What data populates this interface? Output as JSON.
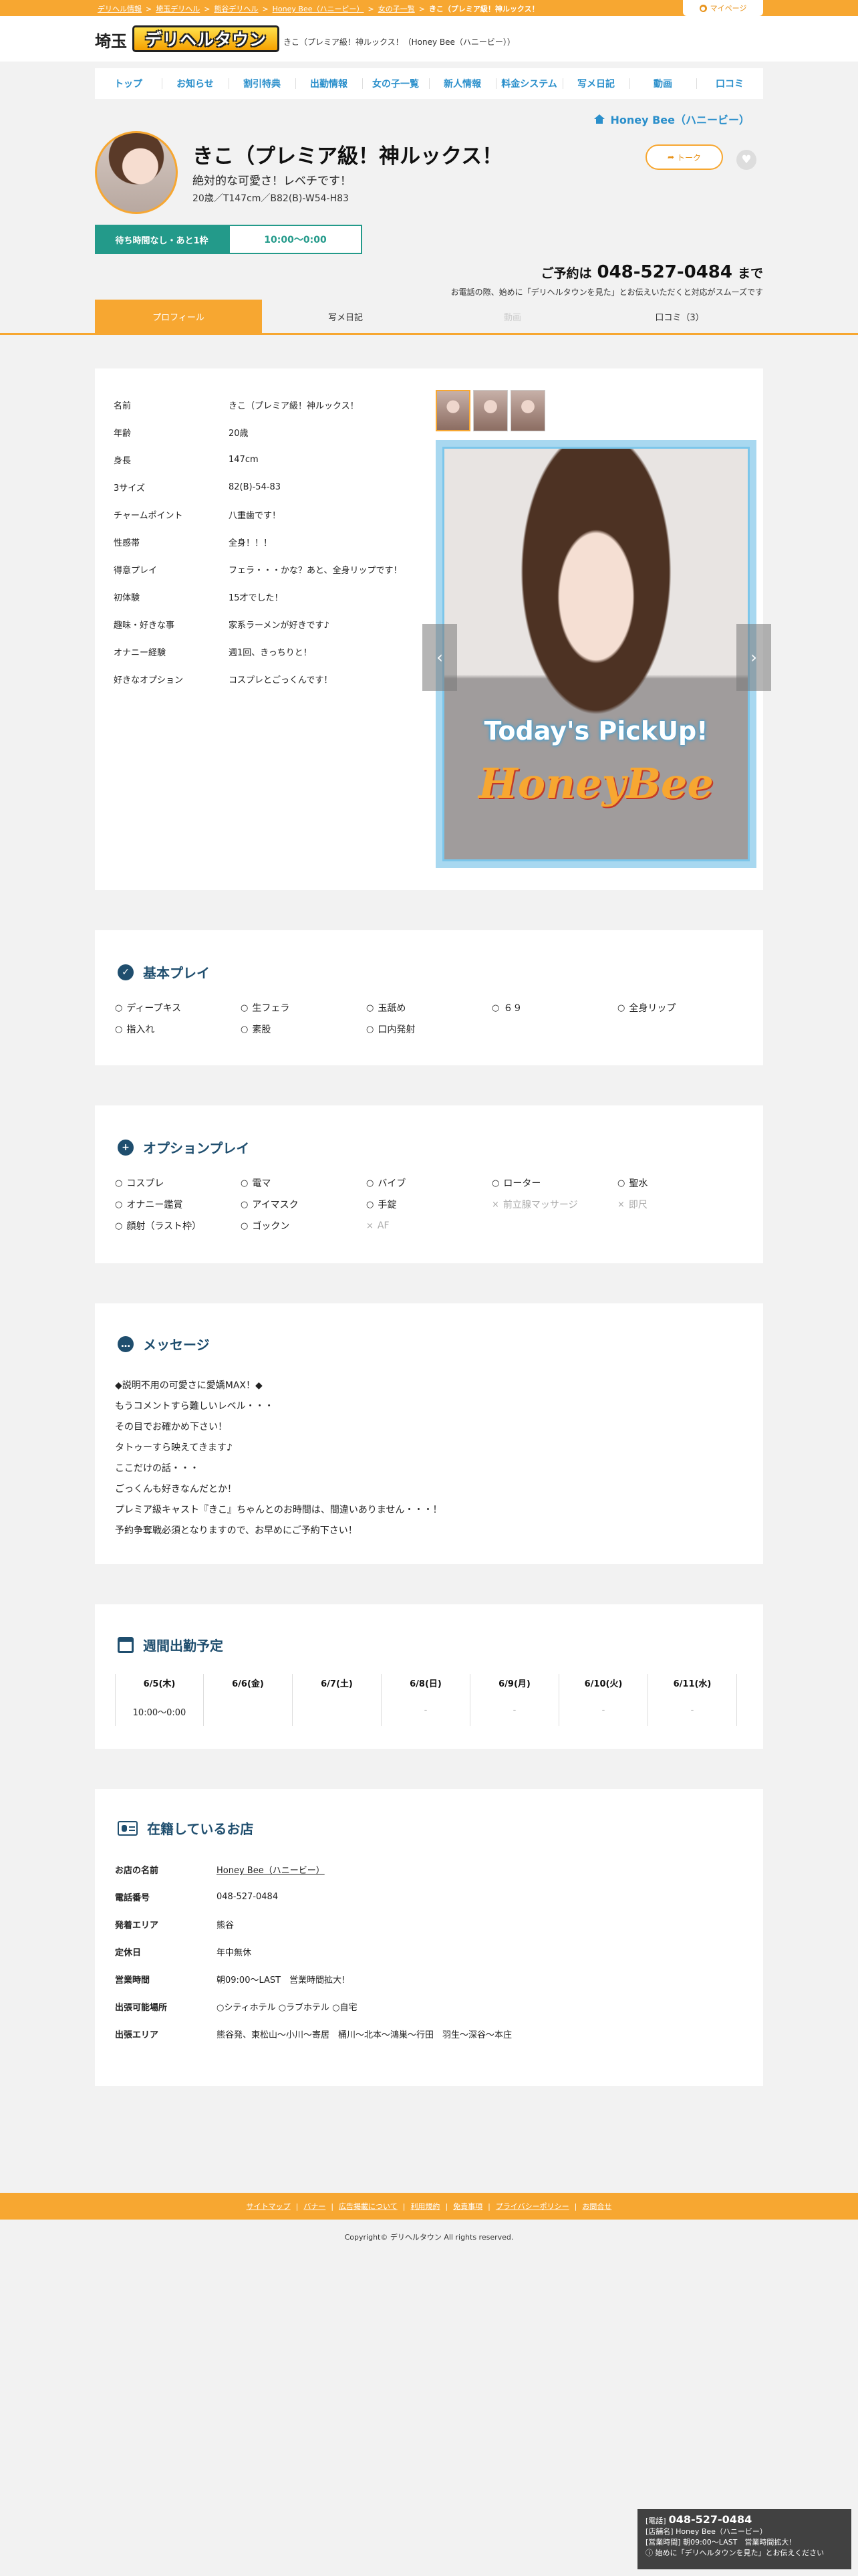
{
  "breadcrumb": {
    "items": [
      "デリヘル情報",
      "埼玉デリヘル",
      "熊谷デリヘル",
      "Honey Bee（ハニービー）",
      "女の子一覧"
    ],
    "separator": ">",
    "current": "きこ（プレミア級！神ルックス！"
  },
  "mypage_label": "マイページ",
  "header": {
    "area": "埼玉",
    "logo_text": "デリヘルタウン",
    "tagline": "きこ（プレミア級！神ルックス！（Honey Bee（ハニービー））"
  },
  "nav": [
    "トップ",
    "お知らせ",
    "割引特典",
    "出勤情報",
    "女の子一覧",
    "新人情報",
    "料金システム",
    "写メ日記",
    "動画",
    "口コミ"
  ],
  "profile": {
    "shop_link": "Honey Bee（ハニービー）",
    "name": "きこ（プレミア級！神ルックス！",
    "catch": "絶対的な可愛さ！レベチです！",
    "spec": "20歳／T147cm／B82(B)-W54-H83",
    "talk_label": "トーク",
    "status_wait": "待ち時間なし・あと1枠",
    "status_time": "10:00〜0:00",
    "reserve_prefix": "ご予約は",
    "reserve_tel": "048-527-0484",
    "reserve_suffix": "まで",
    "reserve_note": "お電話の際、始めに「デリヘルタウンを見た」とお伝えいただくと対応がスムーズです"
  },
  "tabs": [
    {
      "label": "プロフィール",
      "state": "active"
    },
    {
      "label": "写メ日記",
      "state": "normal"
    },
    {
      "label": "動画",
      "state": "disabled"
    },
    {
      "label": "口コミ（3）",
      "state": "normal"
    }
  ],
  "profile_table": [
    {
      "k": "名前",
      "v": "きこ（プレミア級！神ルックス！"
    },
    {
      "k": "年齢",
      "v": "20歳"
    },
    {
      "k": "身長",
      "v": "147cm"
    },
    {
      "k": "3サイズ",
      "v": "82(B)-54-83"
    },
    {
      "k": "チャームポイント",
      "v": "八重歯です！"
    },
    {
      "k": "性感帯",
      "v": "全身！！！"
    },
    {
      "k": "得意プレイ",
      "v": "フェラ・・・かな？あと、全身リップです！"
    },
    {
      "k": "初体験",
      "v": "15才でした！"
    },
    {
      "k": "趣味・好きな事",
      "v": "家系ラーメンが好きです♪"
    },
    {
      "k": "オナニー経験",
      "v": "週1回、きっちりと！"
    },
    {
      "k": "好きなオプション",
      "v": "コスプレとごっくんです！"
    }
  ],
  "photo_text": {
    "pickup": "Today's PickUp!",
    "brand": "HoneyBee"
  },
  "basic_play": {
    "title": "基本プレイ",
    "items": [
      {
        "label": "ディープキス",
        "ok": true
      },
      {
        "label": "生フェラ",
        "ok": true
      },
      {
        "label": "玉舐め",
        "ok": true
      },
      {
        "label": "６９",
        "ok": true
      },
      {
        "label": "全身リップ",
        "ok": true
      },
      {
        "label": "指入れ",
        "ok": true
      },
      {
        "label": "素股",
        "ok": true
      },
      {
        "label": "口内発射",
        "ok": true
      }
    ]
  },
  "option_play": {
    "title": "オプションプレイ",
    "items": [
      {
        "label": "コスプレ",
        "ok": true
      },
      {
        "label": "電マ",
        "ok": true
      },
      {
        "label": "バイブ",
        "ok": true
      },
      {
        "label": "ローター",
        "ok": true
      },
      {
        "label": "聖水",
        "ok": true
      },
      {
        "label": "オナニー鑑賞",
        "ok": true
      },
      {
        "label": "アイマスク",
        "ok": true
      },
      {
        "label": "手錠",
        "ok": true
      },
      {
        "label": "前立腺マッサージ",
        "ok": false
      },
      {
        "label": "即尺",
        "ok": false
      },
      {
        "label": "顔射（ラスト枠）",
        "ok": true
      },
      {
        "label": "ゴックン",
        "ok": true
      },
      {
        "label": "AF",
        "ok": false
      }
    ]
  },
  "message": {
    "title": "メッセージ",
    "lines": [
      "◆説明不用の可愛さに愛嬌MAX！◆",
      "もうコメントすら難しいレベル・・・",
      "その目でお確かめ下さい！",
      "タトゥーすら映えてきます♪",
      "ここだけの話・・・",
      "ごっくんも好きなんだとか！",
      "プレミア級キャスト『きこ』ちゃんとのお時間は、間違いありません・・・！",
      "予約争奪戦必須となりますので、お早めにご予約下さい！"
    ]
  },
  "schedule": {
    "title": "週間出勤予定",
    "days": [
      {
        "date": "6/5(木)",
        "time": "10:00〜0:00"
      },
      {
        "date": "6/6(金)",
        "time": ""
      },
      {
        "date": "6/7(土)",
        "time": ""
      },
      {
        "date": "6/8(日)",
        "time": "-"
      },
      {
        "date": "6/9(月)",
        "time": "-"
      },
      {
        "date": "6/10(火)",
        "time": "-"
      },
      {
        "date": "6/11(水)",
        "time": "-"
      }
    ]
  },
  "shop": {
    "title": "在籍しているお店",
    "rows": [
      {
        "k": "お店の名前",
        "v": "Honey Bee（ハニービー）",
        "link": true
      },
      {
        "k": "電話番号",
        "v": "048-527-0484",
        "link": false
      },
      {
        "k": "発着エリア",
        "v": "熊谷",
        "link": false
      },
      {
        "k": "定休日",
        "v": "年中無休",
        "link": false
      },
      {
        "k": "営業時間",
        "v": "朝09:00〜LAST　営業時間拡大!",
        "link": false
      },
      {
        "k": "出張可能場所",
        "v": "○シティホテル ○ラブホテル ○自宅",
        "link": false
      },
      {
        "k": "出張エリア",
        "v": "熊谷発、東松山〜小川〜寄居　桶川〜北本〜鴻巣〜行田　羽生〜深谷〜本庄",
        "link": false
      }
    ]
  },
  "footer": {
    "links": [
      "サイトマップ",
      "バナー",
      "広告掲載について",
      "利用規約",
      "免責事項",
      "プライバシーポリシー",
      "お問合せ"
    ],
    "copyright": "Copyright© デリヘルタウン All rights reserved."
  },
  "float_contact": {
    "tel_label": "[電話]",
    "tel": "048-527-0484",
    "shop_line": "[店舗名] Honey Bee（ハニービー）",
    "hours_line": "[営業時間] 朝09:00〜LAST　営業時間拡大!",
    "note_line": "始めに「デリヘルタウンを見た」とお伝えください"
  }
}
